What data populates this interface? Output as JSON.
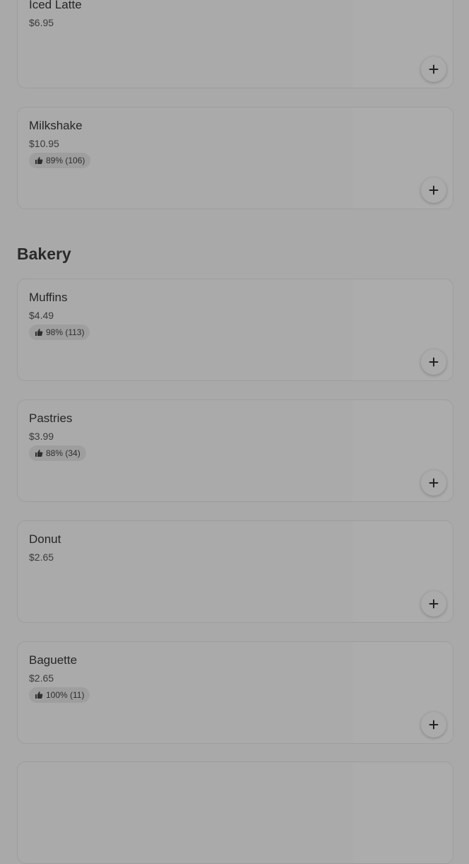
{
  "sections": [
    {
      "items": [
        {
          "name": "Iced Latte",
          "price": "$6.95",
          "rating": ""
        },
        {
          "name": "Milkshake",
          "price": "$10.95",
          "rating": "89% (106)"
        }
      ]
    },
    {
      "title": "Bakery",
      "items": [
        {
          "name": "Muffins",
          "price": "$4.49",
          "rating": "98% (113)"
        },
        {
          "name": "Pastries",
          "price": "$3.99",
          "rating": "88% (34)"
        },
        {
          "name": "Donut",
          "price": "$2.65",
          "rating": ""
        },
        {
          "name": "Baguette",
          "price": "$2.65",
          "rating": "100% (11)"
        }
      ]
    }
  ],
  "icons": {
    "rating": "thumbs-up-icon",
    "add": "plus-icon"
  }
}
